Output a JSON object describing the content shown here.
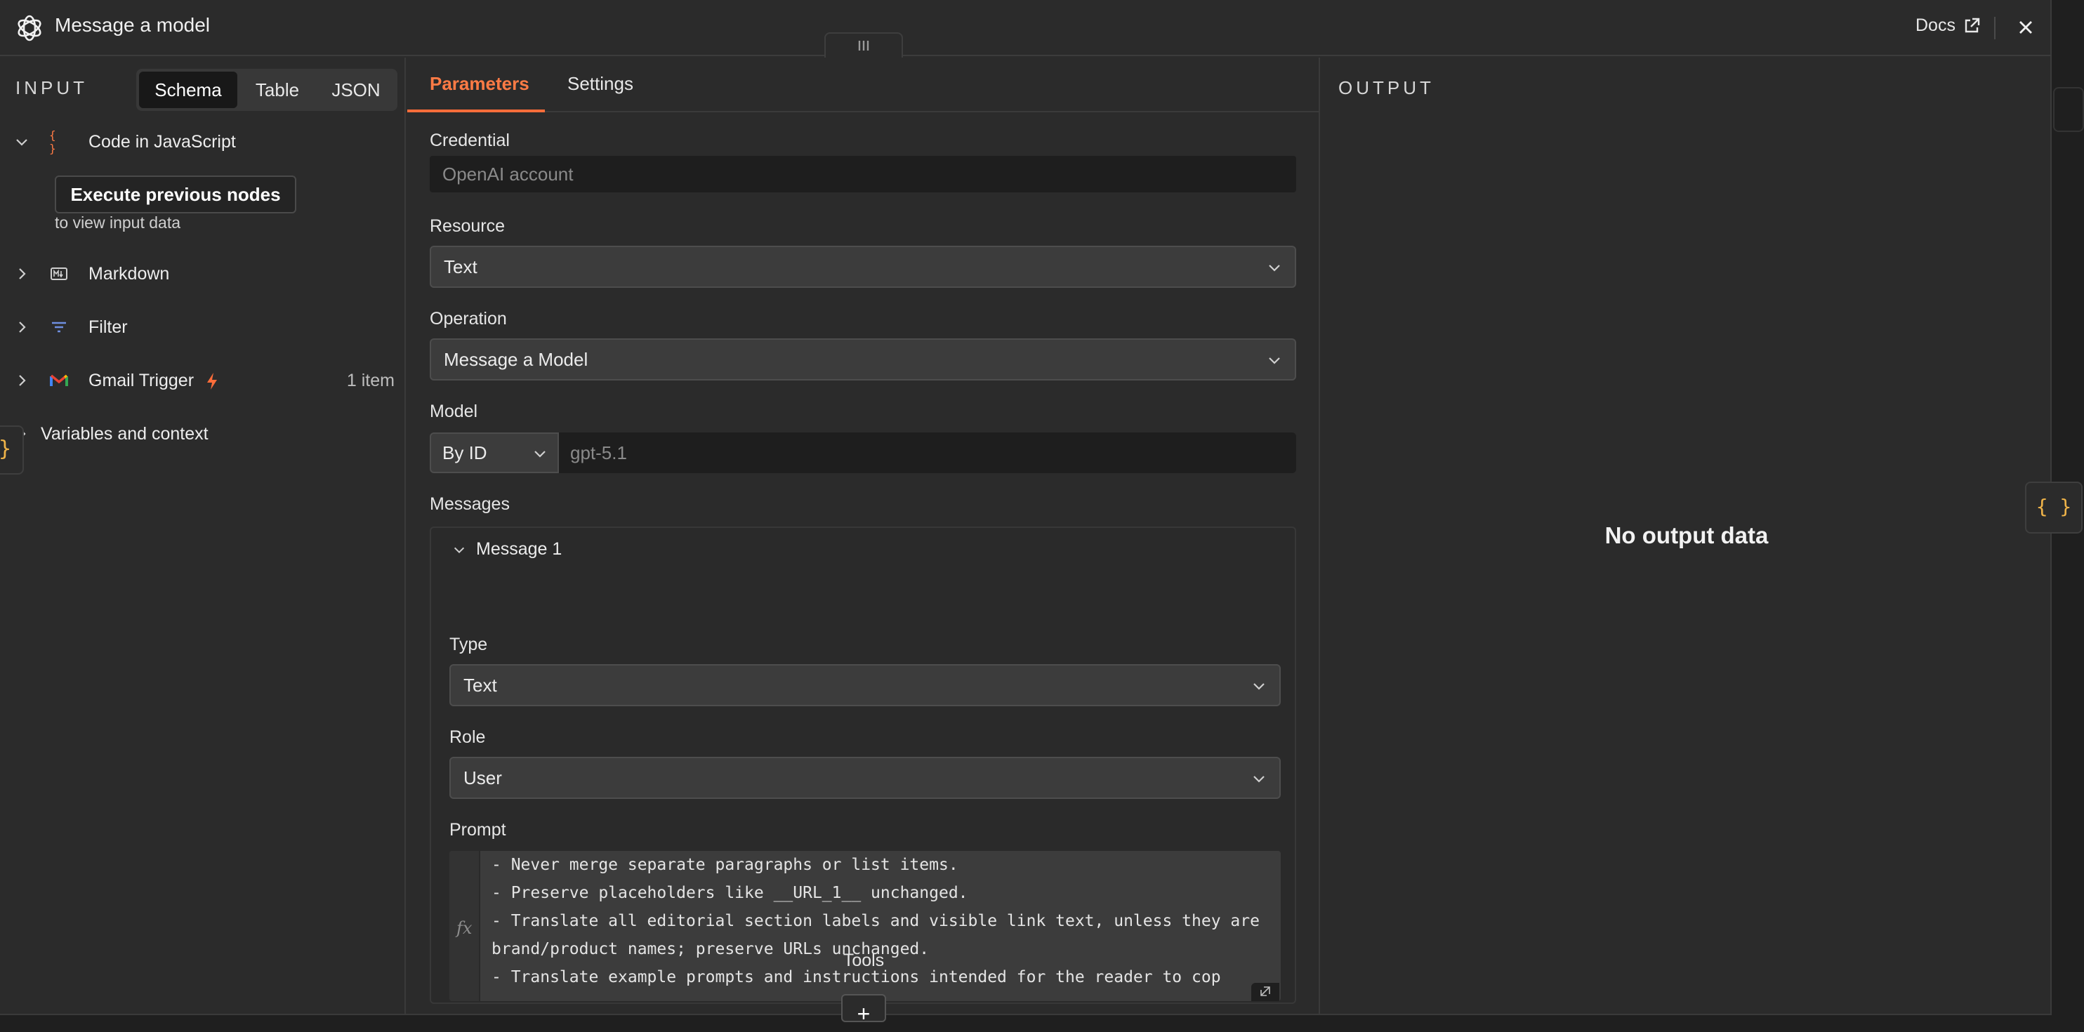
{
  "header": {
    "title": "Message a model",
    "docs_label": "Docs"
  },
  "input": {
    "heading": "INPUT",
    "view_tabs": [
      "Schema",
      "Table",
      "JSON"
    ],
    "active_view": "Schema",
    "nodes": [
      {
        "label": "Code in JavaScript",
        "icon": "braces-icon",
        "expanded": true
      },
      {
        "label": "Markdown",
        "icon": "markdown-icon",
        "expanded": false
      },
      {
        "label": "Filter",
        "icon": "filter-icon",
        "expanded": false
      },
      {
        "label": "Gmail Trigger",
        "icon": "gmail-icon",
        "expanded": false,
        "count": "1 item"
      },
      {
        "label": "Variables and context",
        "expanded": false
      }
    ],
    "execute_button": "Execute previous nodes",
    "execute_hint": "to view input data",
    "side_toggle": "}"
  },
  "params": {
    "tabs": [
      "Parameters",
      "Settings"
    ],
    "active_tab": "Parameters",
    "credential": {
      "label": "Credential",
      "placeholder": "OpenAI account"
    },
    "resource": {
      "label": "Resource",
      "value": "Text"
    },
    "operation": {
      "label": "Operation",
      "value": "Message a Model"
    },
    "model": {
      "label": "Model",
      "mode": "By ID",
      "value": "gpt-5.1"
    },
    "messages": {
      "label": "Messages",
      "item_title": "Message 1",
      "type": {
        "label": "Type",
        "value": "Text"
      },
      "role": {
        "label": "Role",
        "value": "User"
      },
      "prompt": {
        "label": "Prompt",
        "gutter": "fx",
        "text": "- Never merge separate paragraphs or list items.\n- Preserve placeholders like __URL_1__ unchanged.\n- Translate all editorial section labels and visible link text, unless they are brand/product names; preserve URLs unchanged.\n- Translate example prompts and instructions intended for the reader to cop"
      }
    },
    "tools": {
      "label": "Tools",
      "add": "+"
    }
  },
  "output": {
    "heading": "OUTPUT",
    "empty_text": "No output data",
    "side_toggle": "{ }"
  },
  "colors": {
    "accent": "#ff6d3a",
    "expression": "#f0b449",
    "background": "#2b2b2b"
  }
}
